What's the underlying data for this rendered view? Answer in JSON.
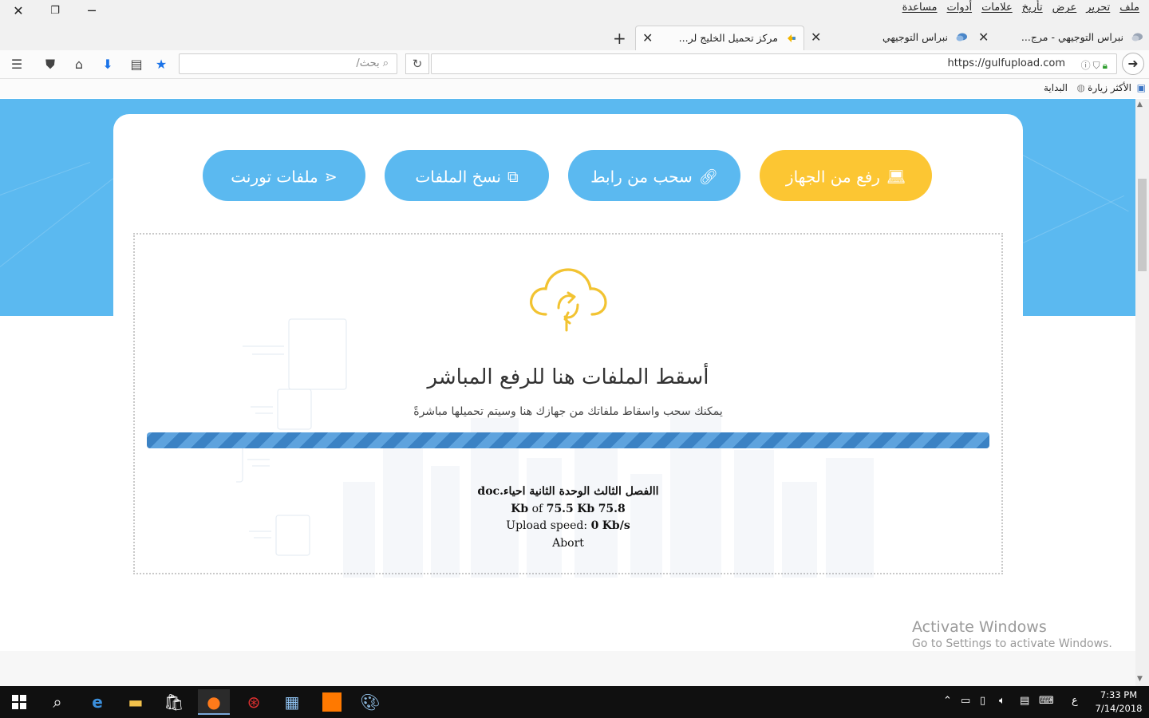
{
  "window": {
    "controls": {
      "close": "✕",
      "restore": "❐",
      "minimize": "─"
    }
  },
  "menubar": [
    "ملف",
    "تحرير",
    "عرض",
    "تأريخ",
    "علامات",
    "أدوات",
    "مساعدة"
  ],
  "tabs": [
    {
      "title": "نبراس التوجيهي - مرج...",
      "active": false
    },
    {
      "title": "نبراس التوجيهي",
      "active": false
    },
    {
      "title": "مركز تحميل الخليج لر...",
      "active": true
    }
  ],
  "navbar": {
    "url": "https://gulfupload.com",
    "search_placeholder": "بحث/"
  },
  "bookmarks": [
    {
      "label": "الأكثر زيارة"
    },
    {
      "label": "البداية"
    }
  ],
  "page": {
    "upload_buttons": [
      {
        "label": "رفع من الجهاز",
        "icon": "laptop-icon",
        "color": "#fcc633"
      },
      {
        "label": "سحب من رابط",
        "icon": "link-icon",
        "color": "#5bb9f0"
      },
      {
        "label": "نسخ الملفات",
        "icon": "copy-icon",
        "color": "#5bb9f0"
      },
      {
        "label": "ملفات تورنت",
        "icon": "share-icon",
        "color": "#5bb9f0"
      }
    ],
    "drop_title": "أسقط الملفات هنا للرفع المباشر",
    "drop_subtitle": "يمكنك سحب واسقاط ملفاتك من جهازك هنا وسيتم تحميلها مباشرةً",
    "upload": {
      "filename": "االفصل الثالث الوحدة الثانية احياء.doc",
      "progress_fraction": 1.0,
      "uploaded": "75.8",
      "total": "75.5",
      "size_unit": "Kb",
      "of_word": "of",
      "speed_label": "Upload speed:",
      "speed_value": "0",
      "speed_unit": "Kb/s",
      "abort_label": "Abort"
    }
  },
  "watermark": {
    "line1": "Activate Windows",
    "line2": "Go to Settings to activate Windows."
  },
  "taskbar": {
    "apps": [
      "windows-start-icon",
      "search-icon",
      "edge-icon",
      "file-explorer-icon",
      "store-icon",
      "firefox-icon",
      "antivirus-icon",
      "control-panel-icon",
      "orange-app-icon",
      "paint-icon"
    ],
    "language": "ع",
    "time": "7:33 PM",
    "date": "7/14/2018"
  },
  "colors": {
    "accent_blue": "#5bb9f0",
    "accent_yellow": "#fcc633",
    "progress_blue": "#3b82c4"
  }
}
